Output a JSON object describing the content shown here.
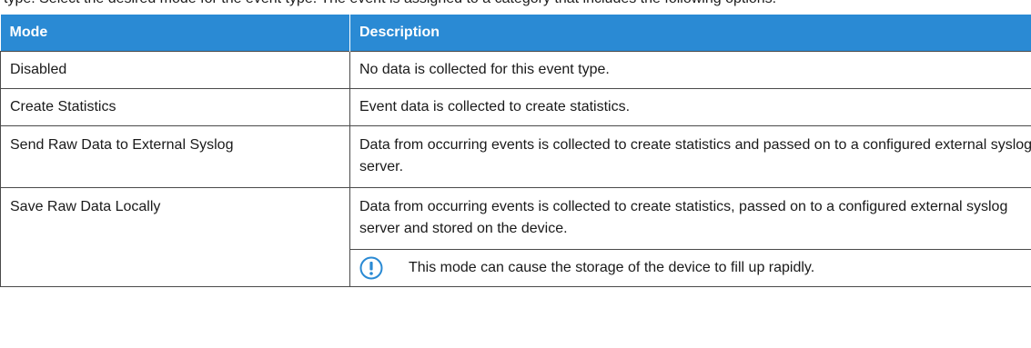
{
  "top_cut_text": "type. Select the desired mode for the event type. The event is assigned to a category that includes the following options:",
  "table": {
    "headers": [
      "Mode",
      "Description"
    ],
    "rows": [
      {
        "mode": "Disabled",
        "description": "No data is collected for this event type."
      },
      {
        "mode": "Create Statistics",
        "description": "Event data is collected to create statistics."
      },
      {
        "mode": "Send Raw Data to External Syslog",
        "description": "Data from occurring events is collected to create statistics and passed on to a configured external syslog server."
      },
      {
        "mode": "Save Raw Data Locally",
        "description": "Data from occurring events is collected to create statistics, passed on to a configured external syslog server and stored on the device.",
        "note": "This mode can cause the storage of the device to fill up rapidly."
      }
    ]
  },
  "colors": {
    "header_bg": "#2a8ad4",
    "header_text": "#ffffff",
    "note_icon": "#2a8ad4"
  },
  "icons": {
    "note": "warning-exclamation-icon"
  }
}
